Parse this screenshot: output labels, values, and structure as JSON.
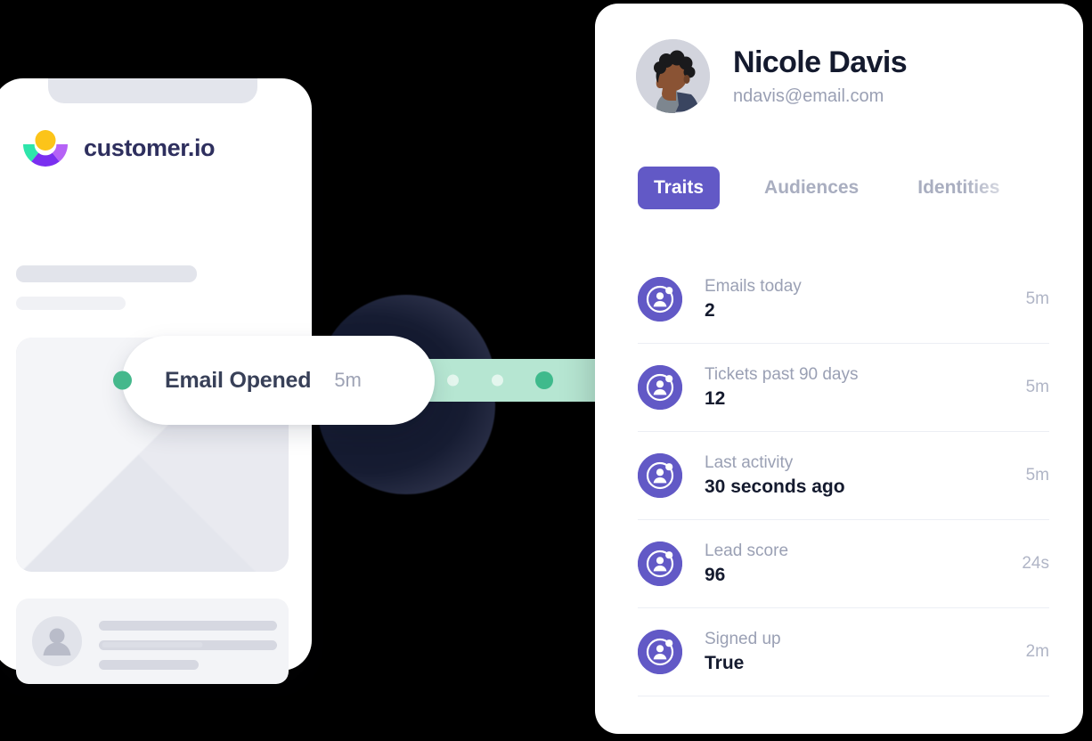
{
  "brand": {
    "logo_icon": "customerio-logo-icon",
    "wordmark": "customer.io",
    "accent_purple": "#6259c6",
    "accent_green": "#45b88c",
    "track_green": "#b6e6d2",
    "logo_yellow": "#fcc419",
    "logo_teal": "#2ee5ab",
    "logo_violet": "#b562f6",
    "logo_purple": "#7a2ff0"
  },
  "phone": {
    "notch": "phone-notch",
    "envelope_placeholder": "email-envelope-illustration",
    "contact_placeholder": "contact-skeleton-card"
  },
  "event_pill": {
    "status_dot": "status-dot-green",
    "label": "Email Opened",
    "time": "5m"
  },
  "timeline_track": {
    "dots": [
      "inactive",
      "inactive",
      "active"
    ]
  },
  "profile": {
    "avatar_icon": "user-avatar",
    "name": "Nicole Davis",
    "email": "ndavis@email.com"
  },
  "tabs": [
    {
      "label": "Traits",
      "active": true
    },
    {
      "label": "Audiences",
      "active": false
    },
    {
      "label": "Identities",
      "active": false
    }
  ],
  "traits": [
    {
      "icon": "person-identity-icon",
      "label": "Emails today",
      "value": "2",
      "time": "5m"
    },
    {
      "icon": "person-identity-icon",
      "label": "Tickets past 90 days",
      "value": "12",
      "time": "5m"
    },
    {
      "icon": "person-identity-icon",
      "label": "Last activity",
      "value": "30 seconds ago",
      "time": "5m"
    },
    {
      "icon": "person-identity-icon",
      "label": "Lead score",
      "value": "96",
      "time": "24s"
    },
    {
      "icon": "person-identity-icon",
      "label": "Signed up",
      "value": "True",
      "time": "2m"
    }
  ]
}
